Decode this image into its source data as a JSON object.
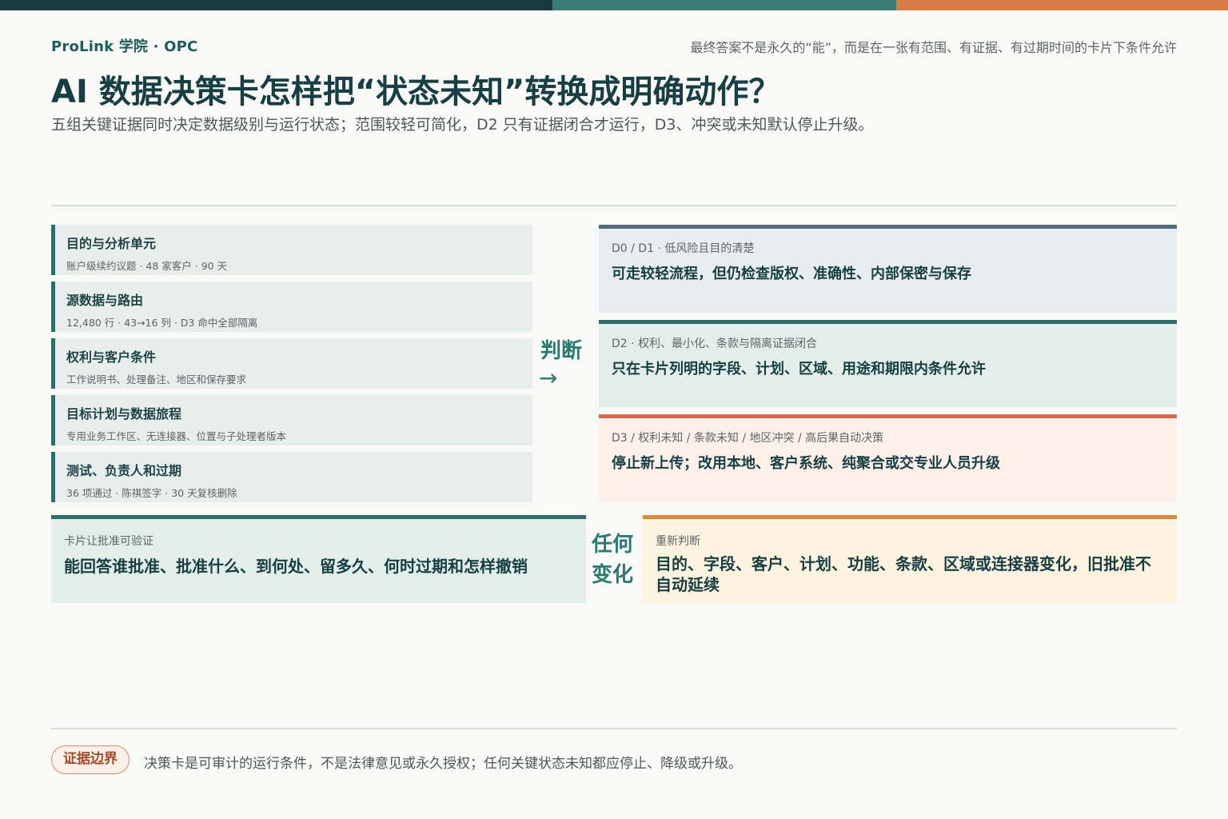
{
  "header": {
    "brand": "ProLink 学院 · OPC",
    "tagline": "最终答案不是永久的“能”，而是在一张有范围、有证据、有过期时间的卡片下条件允许",
    "title": "AI 数据决策卡怎样把“状态未知”转换成明确动作？",
    "subtitle": "五组关键证据同时决定数据级别与运行状态；范围较轻可简化，D2 只有证据闭合才运行，D3、冲突或未知默认停止升级。"
  },
  "evidence": [
    {
      "title": "目的与分析单元",
      "detail": "账户级续约议题 · 48 家客户 · 90 天"
    },
    {
      "title": "源数据与路由",
      "detail": "12,480 行 · 43→16 列 · D3 命中全部隔离"
    },
    {
      "title": "权利与客户条件",
      "detail": "工作说明书、处理备注、地区和保存要求"
    },
    {
      "title": "目标计划与数据旅程",
      "detail": "专用业务工作区、无连接器、位置与子处理者版本"
    },
    {
      "title": "测试、负责人和过期",
      "detail": "36 项通过 · 陈祺签字 · 30 天复核删除"
    }
  ],
  "judge": {
    "label": "判断",
    "arrow": "→"
  },
  "outcomes": [
    {
      "key": "D0 / D1 · 低风险且目的清楚",
      "value": "可走较轻流程，但仍检查版权、准确性、内部保密与保存"
    },
    {
      "key": "D2 · 权利、最小化、条款与隔离证据闭合",
      "value": "只在卡片列明的字段、计划、区域、用途和期限内条件允许"
    },
    {
      "key": "D3 / 权利未知 / 条款未知 / 地区冲突 / 高后果自动决策",
      "value": "停止新上传；改用本地、客户系统、纯聚合或交专业人员升级"
    }
  ],
  "card_value": {
    "key": "卡片让批准可验证",
    "value": "能回答谁批准、批准什么、到何处、留多久、何时过期和怎样撤销"
  },
  "change": {
    "label": "任何变化"
  },
  "rejudge": {
    "key": "重新判断",
    "value": "目的、字段、客户、计划、功能、条款、区域或连接器变化，旧批准不自动延续"
  },
  "footer": {
    "badge": "证据边界",
    "note": "决策卡是可审计的运行条件，不是法律意见或永久授权；任何关键状态未知都应停止、降级或升级。"
  },
  "colors": {
    "dark": "#173a3f",
    "teal": "#3b7c74",
    "orange": "#d87c45",
    "red": "#d76b4d",
    "amber": "#d98b3f"
  }
}
